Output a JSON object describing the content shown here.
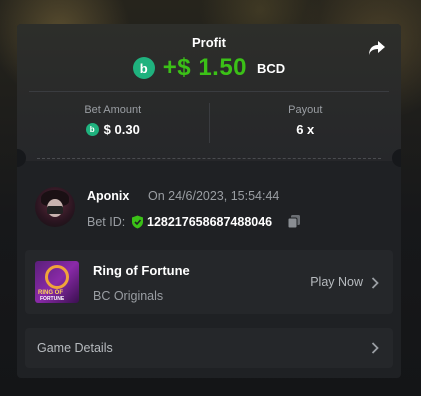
{
  "profit": {
    "label": "Profit",
    "value": "+$ 1.50",
    "currency": "BCD",
    "coin_icon": "bcd-coin-icon",
    "coin_symbol": "b",
    "color": "#3bc117"
  },
  "stats": {
    "bet_amount_label": "Bet Amount",
    "bet_amount_value": "$ 0.30",
    "payout_label": "Payout",
    "payout_value": "6 x"
  },
  "player": {
    "name": "Aponix",
    "date": "On 24/6/2023, 15:54:44",
    "bet_id_label": "Bet ID:",
    "bet_id": "128217658687488046"
  },
  "game": {
    "thumb_line1": "RING OF",
    "thumb_line2": "FORTUNE",
    "title": "Ring of Fortune",
    "provider": "BC Originals",
    "action_label": "Play Now"
  },
  "details": {
    "label": "Game Details"
  },
  "colors": {
    "accent_green": "#3bc117",
    "coin_green": "#1fb27e",
    "card_bg": "#1f2124"
  }
}
